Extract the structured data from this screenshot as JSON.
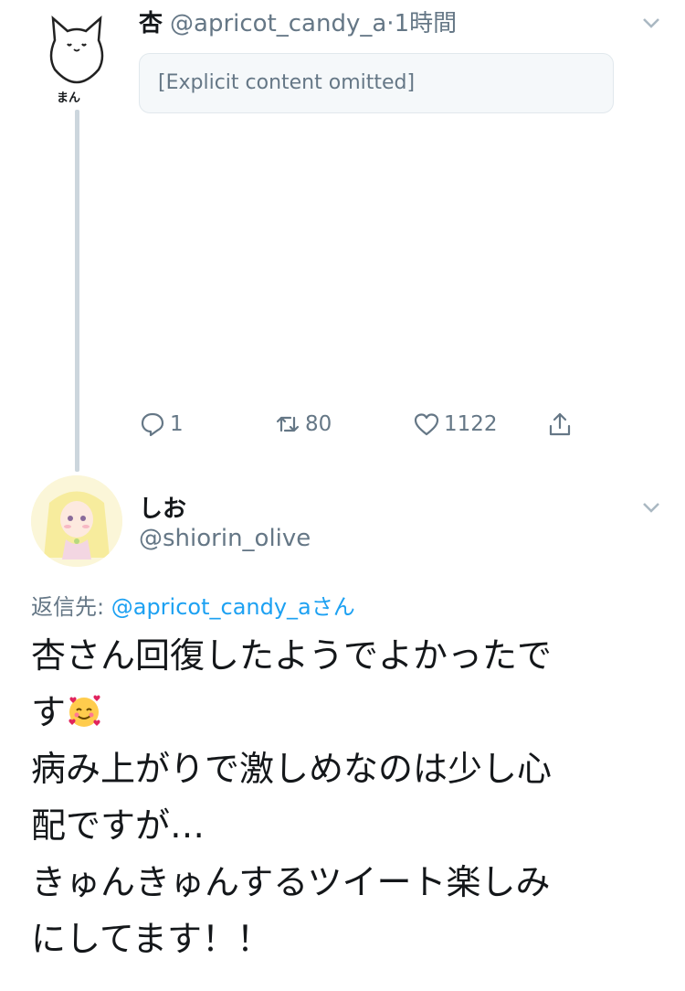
{
  "tweet1": {
    "name": "杏",
    "handle": "@apricot_candy_a",
    "separator": "·",
    "time": "1時間",
    "avatar_caption": "まん",
    "body_notice": "[Explicit content omitted]",
    "counts": {
      "replies": "1",
      "retweets": "80",
      "likes": "1122"
    }
  },
  "tweet2": {
    "name": "しお",
    "handle": "@shiorin_olive",
    "reply_prefix": "返信先:",
    "reply_to": "@apricot_candy_a",
    "reply_suffix": "さん",
    "lines": [
      "杏さん回復したようでよかったで",
      "す",
      "病み上がりで激しめなのは少し心",
      "配ですが…",
      "きゅんきゅんするツイート楽しみ",
      "にしてます！！"
    ]
  },
  "icons": [
    "chevron-down-icon",
    "reply-icon",
    "retweet-icon",
    "like-icon",
    "share-icon",
    "smiling-face-with-hearts-icon"
  ],
  "colors": {
    "accent": "#1da1f2",
    "muted": "#657786",
    "text": "#14171a",
    "line": "#ccd6dd"
  }
}
